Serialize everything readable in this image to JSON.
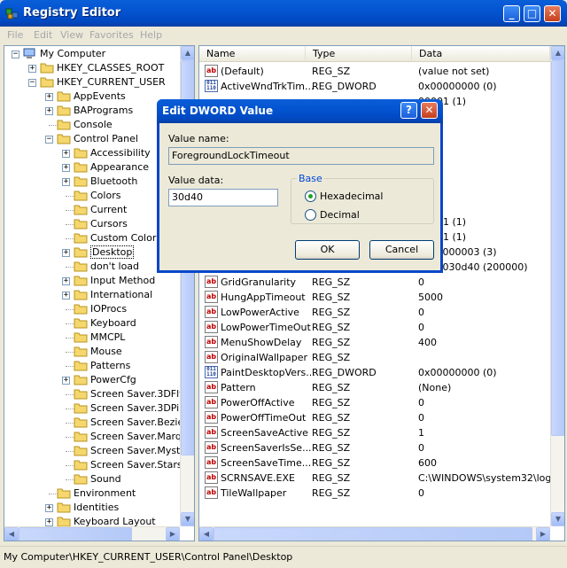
{
  "window": {
    "title": "Registry Editor"
  },
  "menu": [
    "File",
    "Edit",
    "View",
    "Favorites",
    "Help"
  ],
  "tree": [
    {
      "label": "My Computer",
      "level": 0,
      "expander": "-",
      "icon": "computer-icon"
    },
    {
      "label": "HKEY_CLASSES_ROOT",
      "level": 1,
      "expander": "+"
    },
    {
      "label": "HKEY_CURRENT_USER",
      "level": 1,
      "expander": "-"
    },
    {
      "label": "AppEvents",
      "level": 2,
      "expander": "+"
    },
    {
      "label": "BAPrograms",
      "level": 2,
      "expander": "+"
    },
    {
      "label": "Console",
      "level": 2,
      "expander": ""
    },
    {
      "label": "Control Panel",
      "level": 2,
      "expander": "-"
    },
    {
      "label": "Accessibility",
      "level": 3,
      "expander": "+"
    },
    {
      "label": "Appearance",
      "level": 3,
      "expander": "+"
    },
    {
      "label": "Bluetooth",
      "level": 3,
      "expander": "+"
    },
    {
      "label": "Colors",
      "level": 3,
      "expander": ""
    },
    {
      "label": "Current",
      "level": 3,
      "expander": ""
    },
    {
      "label": "Cursors",
      "level": 3,
      "expander": ""
    },
    {
      "label": "Custom Colors",
      "level": 3,
      "expander": ""
    },
    {
      "label": "Desktop",
      "level": 3,
      "expander": "+",
      "selected": true
    },
    {
      "label": "don't load",
      "level": 3,
      "expander": ""
    },
    {
      "label": "Input Method",
      "level": 3,
      "expander": "+"
    },
    {
      "label": "International",
      "level": 3,
      "expander": "+"
    },
    {
      "label": "IOProcs",
      "level": 3,
      "expander": ""
    },
    {
      "label": "Keyboard",
      "level": 3,
      "expander": ""
    },
    {
      "label": "MMCPL",
      "level": 3,
      "expander": ""
    },
    {
      "label": "Mouse",
      "level": 3,
      "expander": ""
    },
    {
      "label": "Patterns",
      "level": 3,
      "expander": ""
    },
    {
      "label": "PowerCfg",
      "level": 3,
      "expander": "+"
    },
    {
      "label": "Screen Saver.3DFly",
      "level": 3,
      "expander": ""
    },
    {
      "label": "Screen Saver.3DPip",
      "level": 3,
      "expander": ""
    },
    {
      "label": "Screen Saver.Bezier",
      "level": 3,
      "expander": ""
    },
    {
      "label": "Screen Saver.Marqu",
      "level": 3,
      "expander": ""
    },
    {
      "label": "Screen Saver.Mystif",
      "level": 3,
      "expander": ""
    },
    {
      "label": "Screen Saver.Stars",
      "level": 3,
      "expander": ""
    },
    {
      "label": "Sound",
      "level": 3,
      "expander": ""
    },
    {
      "label": "Environment",
      "level": 2,
      "expander": ""
    },
    {
      "label": "Identities",
      "level": 2,
      "expander": "+"
    },
    {
      "label": "Keyboard Layout",
      "level": 2,
      "expander": "+"
    }
  ],
  "columns": {
    "name": "Name",
    "type": "Type",
    "data": "Data"
  },
  "values": [
    {
      "name": "(Default)",
      "type": "REG_SZ",
      "data": "(value not set)",
      "kind": "sz"
    },
    {
      "name": "ActiveWndTrkTim...",
      "type": "REG_DWORD",
      "data": "0x00000000 (0)",
      "kind": "bin"
    },
    {
      "name": "",
      "type": "",
      "data": "00001 (1)",
      "kind": "bin"
    },
    {
      "name": "",
      "type": "",
      "data": "",
      "kind": "none"
    },
    {
      "name": "",
      "type": "",
      "data": "",
      "kind": "none"
    },
    {
      "name": "",
      "type": "",
      "data": "",
      "kind": "none"
    },
    {
      "name": "",
      "type": "",
      "data": "",
      "kind": "none"
    },
    {
      "name": "",
      "type": "",
      "data": "",
      "kind": "none"
    },
    {
      "name": "",
      "type": "",
      "data": "",
      "kind": "none"
    },
    {
      "name": "",
      "type": "",
      "data": "",
      "kind": "none"
    },
    {
      "name": "",
      "type": "",
      "data": "00001 (1)",
      "kind": "bin"
    },
    {
      "name": "",
      "type": "",
      "data": "00001 (1)",
      "kind": "bin"
    },
    {
      "name": "ForegroundFlash...",
      "type": "REG_DWORD",
      "data": "0x00000003 (3)",
      "kind": "bin"
    },
    {
      "name": "ForegroundLockT...",
      "type": "REG_DWORD",
      "data": "0x00030d40 (200000)",
      "kind": "bin"
    },
    {
      "name": "GridGranularity",
      "type": "REG_SZ",
      "data": "0",
      "kind": "sz"
    },
    {
      "name": "HungAppTimeout",
      "type": "REG_SZ",
      "data": "5000",
      "kind": "sz"
    },
    {
      "name": "LowPowerActive",
      "type": "REG_SZ",
      "data": "0",
      "kind": "sz"
    },
    {
      "name": "LowPowerTimeOut",
      "type": "REG_SZ",
      "data": "0",
      "kind": "sz"
    },
    {
      "name": "MenuShowDelay",
      "type": "REG_SZ",
      "data": "400",
      "kind": "sz"
    },
    {
      "name": "OriginalWallpaper",
      "type": "REG_SZ",
      "data": "",
      "kind": "sz"
    },
    {
      "name": "PaintDesktopVers...",
      "type": "REG_DWORD",
      "data": "0x00000000 (0)",
      "kind": "bin"
    },
    {
      "name": "Pattern",
      "type": "REG_SZ",
      "data": "(None)",
      "kind": "sz"
    },
    {
      "name": "PowerOffActive",
      "type": "REG_SZ",
      "data": "0",
      "kind": "sz"
    },
    {
      "name": "PowerOffTimeOut",
      "type": "REG_SZ",
      "data": "0",
      "kind": "sz"
    },
    {
      "name": "ScreenSaveActive",
      "type": "REG_SZ",
      "data": "1",
      "kind": "sz"
    },
    {
      "name": "ScreenSaverIsSe...",
      "type": "REG_SZ",
      "data": "0",
      "kind": "sz"
    },
    {
      "name": "ScreenSaveTime...",
      "type": "REG_SZ",
      "data": "600",
      "kind": "sz"
    },
    {
      "name": "SCRNSAVE.EXE",
      "type": "REG_SZ",
      "data": "C:\\WINDOWS\\system32\\logon",
      "kind": "sz"
    },
    {
      "name": "TileWallpaper",
      "type": "REG_SZ",
      "data": "0",
      "kind": "sz"
    }
  ],
  "dialog": {
    "title": "Edit DWORD Value",
    "value_name_label": "Value name:",
    "value_name": "ForegroundLockTimeout",
    "value_data_label": "Value data:",
    "value_data": "30d40",
    "base_label": "Base",
    "hex_label": "Hexadecimal",
    "dec_label": "Decimal",
    "base_selected": "Hexadecimal",
    "ok_label": "OK",
    "cancel_label": "Cancel"
  },
  "status": {
    "path": "My Computer\\HKEY_CURRENT_USER\\Control Panel\\Desktop"
  },
  "colors": {
    "titlebar": "#0454d0",
    "selection": "#316ac5",
    "window_bg": "#ece9d8"
  }
}
